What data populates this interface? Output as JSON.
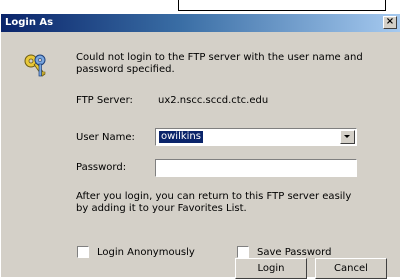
{
  "dialog": {
    "title": "Login As",
    "close_label": "×",
    "message": "Could not login to the FTP server with the user name and password specified.",
    "ftp_server_label": "FTP Server:",
    "ftp_server_value": "ux2.nscc.sccd.ctc.edu",
    "user_name_label": "User Name:",
    "user_name_value": "owilkins",
    "password_label": "Password:",
    "password_value": "",
    "info_text": "After you login, you can return to this FTP server easily by adding it to your Favorites List.",
    "login_anonymously_label": "Login Anonymously",
    "login_anonymously_checked": false,
    "save_password_label": "Save Password",
    "save_password_checked": false,
    "login_button_label": "Login",
    "cancel_button_label": "Cancel"
  },
  "icons": {
    "dialog_icon": "keys-icon",
    "combo_arrow": "chevron-down-icon"
  },
  "colors": {
    "title_gradient_start": "#0a246a",
    "title_gradient_end": "#a6caf0",
    "window_bg": "#d4d0c8",
    "selection_bg": "#0a246a"
  }
}
